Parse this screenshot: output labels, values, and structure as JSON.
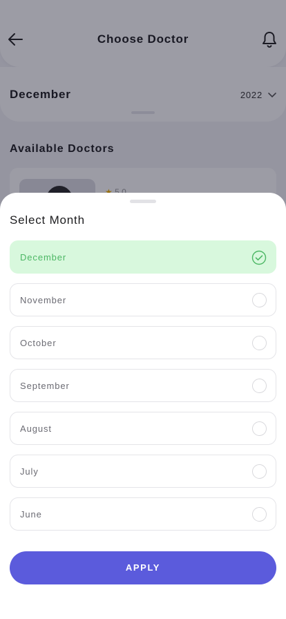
{
  "header": {
    "title": "Choose Doctor",
    "back_icon": "arrow-left-icon",
    "notification_icon": "bell-icon"
  },
  "month_filter": {
    "month": "December",
    "year": "2022"
  },
  "available": {
    "title": "Available Doctors",
    "rating": "5.0"
  },
  "sheet": {
    "title": "Select Month",
    "options": [
      {
        "label": "December",
        "selected": true
      },
      {
        "label": "November",
        "selected": false
      },
      {
        "label": "October",
        "selected": false
      },
      {
        "label": "September",
        "selected": false
      },
      {
        "label": "August",
        "selected": false
      },
      {
        "label": "July",
        "selected": false
      },
      {
        "label": "June",
        "selected": false
      }
    ],
    "apply_label": "APPLY"
  },
  "colors": {
    "accent": "#5b5bdc",
    "selected_bg": "#d8f8dd",
    "selected_text": "#4cb764"
  }
}
